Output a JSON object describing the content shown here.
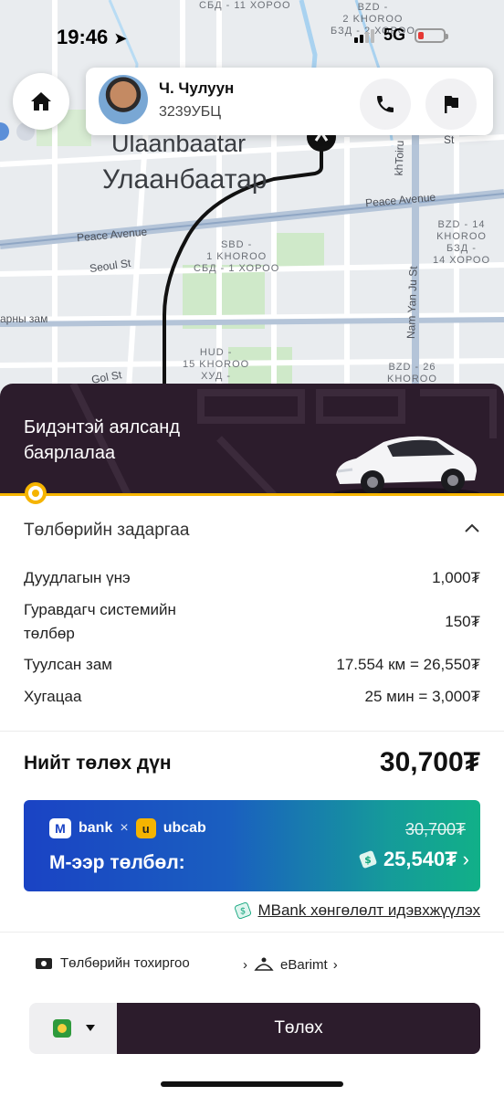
{
  "status_bar": {
    "time": "19:46",
    "network": "5G"
  },
  "map": {
    "city_en": "Ulaanbaatar",
    "city_mn": "Улаанбаатар",
    "labels": {
      "sbd11": "СБД -\n11 ХОРОО",
      "bzd2": "BZD -\n2 KHOROO\nБЗД - 2 ХОРОО",
      "sbd1": "SBD -\n1 KHOROO\nСБД - 1 ХОРОО",
      "bzd14": "BZD - 14\nKHOROO\nБЗД -\n14 ХОРОО",
      "hud15": "HUD -\n15 KHOROO\nХУД -",
      "bzd26": "BZD - 26\nKHOROO"
    },
    "roads": {
      "peace_avenue_left": "Peace Avenue",
      "peace_avenue_right": "Peace Avenue",
      "seoul_st": "Seoul St",
      "namyanju_st": "Nam Yan Ju St",
      "arny_zam": "арны зам",
      "gol_st": "Gol St",
      "khtoiru": "khToiru",
      "st_right": "St"
    }
  },
  "driver": {
    "name": "Ч. Чулуун",
    "plate": "3239УБЦ"
  },
  "banner": {
    "message": "Бидэнтэй аялсанд баярлалаа"
  },
  "breakdown": {
    "title": "Төлбөрийн задаргаа",
    "rows": [
      {
        "label": "Дуудлагын үнэ",
        "value": "1,000₮"
      },
      {
        "label": "Гуравдагч системийн төлбөр",
        "value": "150₮"
      },
      {
        "label": "Туулсан зам",
        "value": "17.554 км = 26,550₮"
      },
      {
        "label": "Хугацаа",
        "value": "25 мин = 3,000₮"
      }
    ]
  },
  "total": {
    "label": "Нийт төлөх дүн",
    "value": "30,700₮"
  },
  "promo": {
    "brand1": "bank",
    "brand1_badge": "M",
    "brand2": "ubcab",
    "brand2_badge": "u",
    "separator": "×",
    "old_price": "30,700₮",
    "label": "М-ээр төлбөл:",
    "new_price": "25,540₮"
  },
  "mbank_link": "MBank хөнгөлөлт идэвхжүүлэх",
  "footer": {
    "payment_settings": "Төлбөрийн тохиргоо",
    "ebarimt": "eBarimt"
  },
  "pay_button": "Төлөх",
  "colors": {
    "banner_bg": "#2c1c2c",
    "accent_yellow": "#f5b400",
    "promo_start": "#1a43c4",
    "promo_end": "#11b088",
    "route": "#111111"
  }
}
